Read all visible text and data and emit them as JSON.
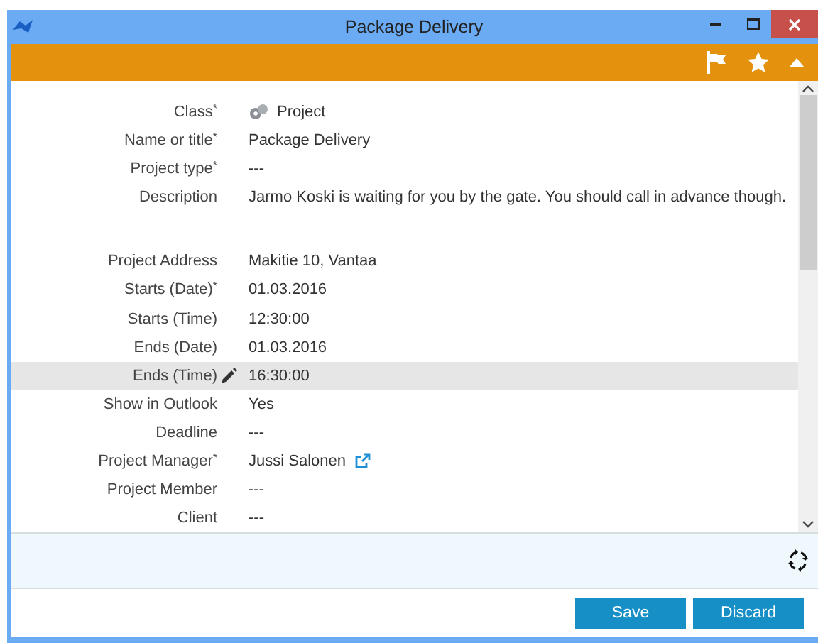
{
  "window": {
    "title": "Package Delivery"
  },
  "fields": [
    {
      "label": "Class$^{*}$",
      "value": "Project",
      "kind": "class",
      "selected": false
    },
    {
      "label": "Name or title$^{*}$",
      "value": "Package Delivery",
      "kind": "text",
      "selected": false
    },
    {
      "label": "Project type$^{*}$",
      "value": "---",
      "kind": "text",
      "selected": false
    },
    {
      "label": "Description",
      "value": "Jarmo Koski is waiting for you by the gate. You should call in advance though.",
      "kind": "multiline",
      "selected": false
    },
    {
      "label": "Project Address",
      "value": "Makitie 10, Vantaa",
      "kind": "text",
      "selected": false
    },
    {
      "label": "Starts (Date)$^{*}$",
      "value": "01.03.2016",
      "kind": "text",
      "selected": false
    },
    {
      "label": "Starts (Time)",
      "value": "12:30:00",
      "kind": "text",
      "selected": false
    },
    {
      "label": "Ends (Date)",
      "value": "01.03.2016",
      "kind": "text",
      "selected": false
    },
    {
      "label": "Ends (Time)",
      "value": "16:30:00",
      "kind": "text",
      "selected": true
    },
    {
      "label": "Show in Outlook",
      "value": "Yes",
      "kind": "text",
      "selected": false
    },
    {
      "label": "Deadline",
      "value": "---",
      "kind": "text",
      "selected": false
    },
    {
      "label": "Project Manager$^{*}$",
      "value": "Jussi Salonen",
      "kind": "link",
      "selected": false
    },
    {
      "label": "Project Member",
      "value": "---",
      "kind": "text",
      "selected": false
    },
    {
      "label": "Client",
      "value": "---",
      "kind": "text",
      "selected": false
    }
  ],
  "buttons": [
    {
      "label": "Save"
    },
    {
      "label": "Discard"
    }
  ]
}
